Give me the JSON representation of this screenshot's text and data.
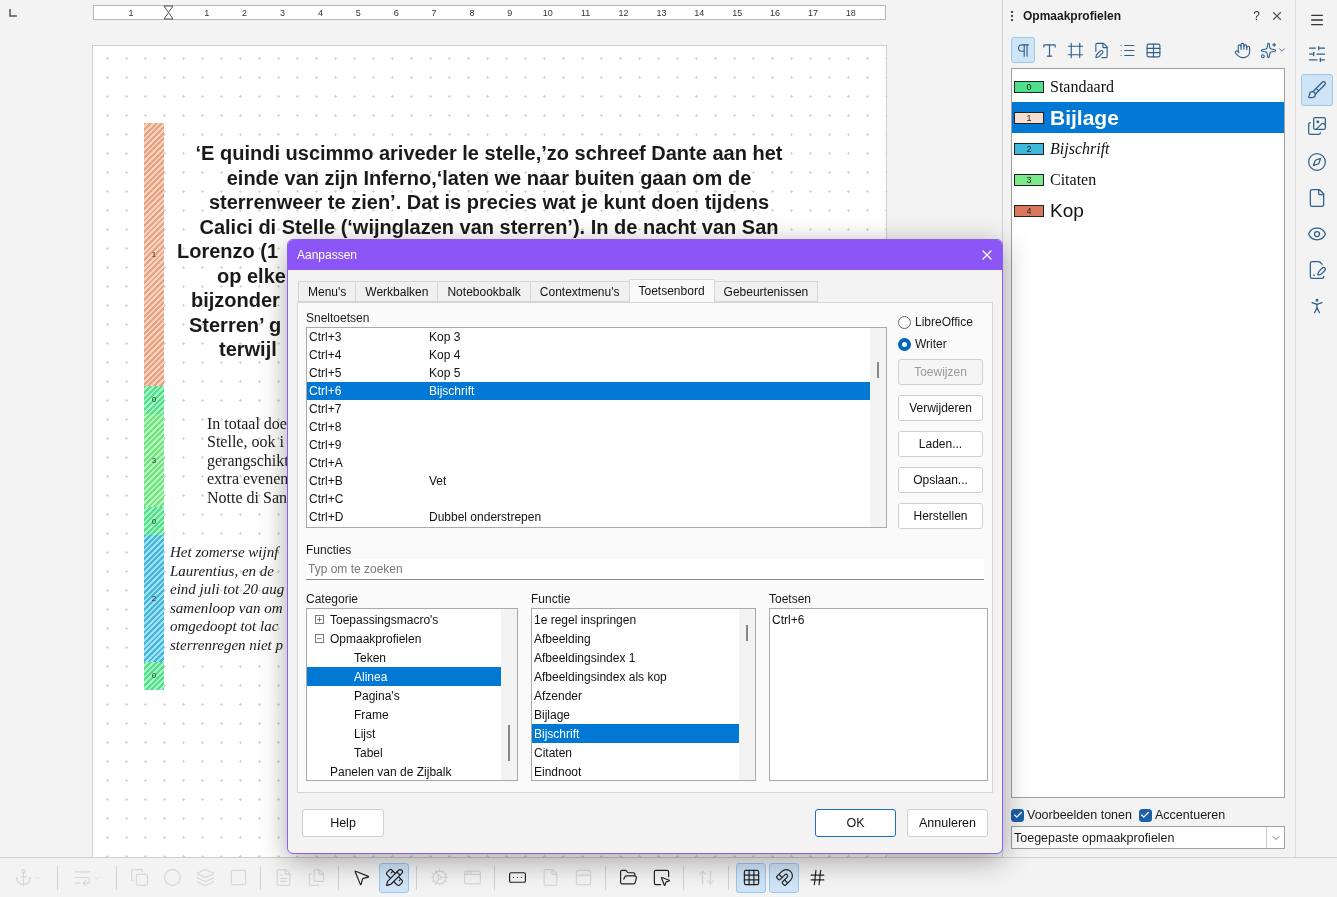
{
  "ruler": {
    "numbers": [
      "1",
      "1",
      "2",
      "3",
      "4",
      "5",
      "6",
      "7",
      "8",
      "9",
      "10",
      "11",
      "12",
      "13",
      "14",
      "15",
      "16",
      "17",
      "18"
    ]
  },
  "document": {
    "paragraphs": [
      {
        "kind": "heading",
        "style_number": "1",
        "color": "#e9a27f",
        "lines": [
          "‘E quindi uscimmo ariveder le stelle,’zo schreef Dante aan het",
          "einde van zijn Inferno,‘laten we naar buiten gaan om de",
          "sterrenweer te zien’. Dat is precies wat je kunt doen tijdens",
          "Calici di Stelle (‘wijnglazen van sterren’). In de nacht van San",
          "Lorenzo (1",
          "op elke",
          "bijzonder",
          "Sterren’ g",
          "terwijl"
        ]
      },
      {
        "kind": "empty",
        "style_number": "0",
        "color": "#4ee08a"
      },
      {
        "kind": "quote",
        "style_number": "3",
        "color": "#6ee67e",
        "lines": [
          "In totaal doe",
          "Stelle, ook i",
          "gerangschikt",
          "extra evenen",
          "Notte di San"
        ]
      },
      {
        "kind": "empty",
        "style_number": "0",
        "color": "#4ee08a"
      },
      {
        "kind": "caption",
        "style_number": "2",
        "color": "#3fb8dc",
        "lines": [
          "Het zomerse wijnf",
          "Laurentius, en de",
          "eind juli tot 20 aug",
          "samenloop van om",
          "omgedoopt tot lac",
          "sterrenregen niet p"
        ]
      },
      {
        "kind": "empty",
        "style_number": "0",
        "color": "#4ee08a"
      }
    ]
  },
  "dialog": {
    "title": "Aanpassen",
    "tabs": [
      {
        "label": "Menu's",
        "selected": false
      },
      {
        "label": "Werkbalken",
        "selected": false
      },
      {
        "label": "Notebookbalk",
        "selected": false
      },
      {
        "label": "Contextmenu's",
        "selected": false
      },
      {
        "label": "Toetsenbord",
        "selected": true
      },
      {
        "label": "Gebeurtenissen",
        "selected": false
      }
    ],
    "shortcuts": {
      "label": "Sneltoetsen",
      "rows": [
        {
          "key": "Ctrl+3",
          "function": "Kop 3",
          "selected": false
        },
        {
          "key": "Ctrl+4",
          "function": "Kop 4",
          "selected": false
        },
        {
          "key": "Ctrl+5",
          "function": "Kop 5",
          "selected": false
        },
        {
          "key": "Ctrl+6",
          "function": "Bijschrift",
          "selected": true
        },
        {
          "key": "Ctrl+7",
          "function": "",
          "selected": false
        },
        {
          "key": "Ctrl+8",
          "function": "",
          "selected": false
        },
        {
          "key": "Ctrl+9",
          "function": "",
          "selected": false
        },
        {
          "key": "Ctrl+A",
          "function": "",
          "selected": false
        },
        {
          "key": "Ctrl+B",
          "function": "Vet",
          "selected": false
        },
        {
          "key": "Ctrl+C",
          "function": "",
          "selected": false
        },
        {
          "key": "Ctrl+D",
          "function": "Dubbel onderstrepen",
          "selected": false
        }
      ]
    },
    "scope": [
      {
        "label": "LibreOffice",
        "selected": false
      },
      {
        "label": "Writer",
        "selected": true
      }
    ],
    "side_buttons": [
      {
        "label": "Toewijzen",
        "disabled": true
      },
      {
        "label": "Verwijderen",
        "disabled": false
      },
      {
        "label": "Laden...",
        "disabled": false
      },
      {
        "label": "Opslaan...",
        "disabled": false
      },
      {
        "label": "Herstellen",
        "disabled": false
      }
    ],
    "functions": {
      "label": "Functies",
      "placeholder": "Typ om te zoeken"
    },
    "category": {
      "label": "Categorie",
      "tree": [
        {
          "label": "Toepassingsmacro's",
          "expanded": false,
          "selected": false
        },
        {
          "label": "Opmaakprofielen",
          "expanded": true,
          "selected": false,
          "children": [
            {
              "label": "Teken",
              "selected": false
            },
            {
              "label": "Alinea",
              "selected": true
            },
            {
              "label": "Pagina's",
              "selected": false
            },
            {
              "label": "Frame",
              "selected": false
            },
            {
              "label": "Lijst",
              "selected": false
            },
            {
              "label": "Tabel",
              "selected": false
            }
          ]
        },
        {
          "label": "Panelen van de Zijbalk",
          "selected": false
        }
      ]
    },
    "function": {
      "label": "Functie",
      "items": [
        {
          "label": "1e regel inspringen",
          "selected": false
        },
        {
          "label": "Afbeelding",
          "selected": false
        },
        {
          "label": "Afbeeldingsindex 1",
          "selected": false
        },
        {
          "label": "Afbeeldingsindex als kop",
          "selected": false
        },
        {
          "label": "Afzender",
          "selected": false
        },
        {
          "label": "Bijlage",
          "selected": false
        },
        {
          "label": "Bijschrift",
          "selected": true
        },
        {
          "label": "Citaten",
          "selected": false
        },
        {
          "label": "Eindnoot",
          "selected": false
        }
      ]
    },
    "keys": {
      "label": "Toetsen",
      "items": [
        "Ctrl+6"
      ]
    },
    "buttons": [
      {
        "label": "Help",
        "kind": "help"
      },
      {
        "label": "OK",
        "kind": "default"
      },
      {
        "label": "Annuleren",
        "kind": "normal"
      }
    ]
  },
  "sidebar": {
    "title": "Opmaakprofielen",
    "help": "?",
    "toolbar": [
      {
        "selected": true
      },
      {
        "selected": false
      },
      {
        "selected": false
      },
      {
        "selected": false
      },
      {
        "selected": false
      },
      {
        "selected": false
      },
      {
        "selected": false
      },
      {
        "selected": false
      }
    ],
    "styles": [
      {
        "number": "0",
        "name": "Standaard",
        "color": "#4ee08a",
        "kind": "standard",
        "selected": false
      },
      {
        "number": "1",
        "name": "Bijlage",
        "color": "#f5ddd2",
        "kind": "appendix",
        "selected": true
      },
      {
        "number": "2",
        "name": "Bijschrift",
        "color": "#3fb8dc",
        "kind": "caption",
        "selected": false
      },
      {
        "number": "3",
        "name": "Citaten",
        "color": "#7be88a",
        "kind": "quote",
        "selected": false
      },
      {
        "number": "4",
        "name": "Kop",
        "color": "#d9785c",
        "kind": "heading",
        "selected": false
      }
    ],
    "options": [
      {
        "label": "Voorbeelden tonen",
        "checked": true
      },
      {
        "label": "Accentueren",
        "checked": true
      }
    ],
    "filter": "Toegepaste opmaakprofielen"
  },
  "tabbar": [
    {
      "selected": false
    },
    {
      "selected": true
    },
    {
      "selected": false
    },
    {
      "selected": false
    },
    {
      "selected": false
    },
    {
      "selected": false
    },
    {
      "selected": false
    },
    {
      "selected": false
    }
  ],
  "toolbar": [
    {
      "selected": false,
      "disabled": true
    },
    {
      "selected": false,
      "disabled": true
    },
    {
      "selected": false,
      "disabled": true
    },
    {
      "selected": false,
      "disabled": true
    },
    {
      "selected": false,
      "disabled": true
    },
    {
      "selected": false,
      "disabled": true
    },
    {
      "selected": false,
      "disabled": true
    },
    {
      "selected": false,
      "disabled": true
    },
    {
      "selected": false,
      "disabled": false
    },
    {
      "selected": true,
      "disabled": false
    },
    {
      "selected": false,
      "disabled": true
    },
    {
      "selected": false,
      "disabled": true
    },
    {
      "selected": false,
      "disabled": false
    },
    {
      "selected": false,
      "disabled": true
    },
    {
      "selected": false,
      "disabled": true
    },
    {
      "selected": false,
      "disabled": false
    },
    {
      "selected": false,
      "disabled": false
    },
    {
      "selected": false,
      "disabled": true
    },
    {
      "selected": true,
      "disabled": false
    },
    {
      "selected": true,
      "disabled": false
    },
    {
      "selected": false,
      "disabled": false
    }
  ]
}
